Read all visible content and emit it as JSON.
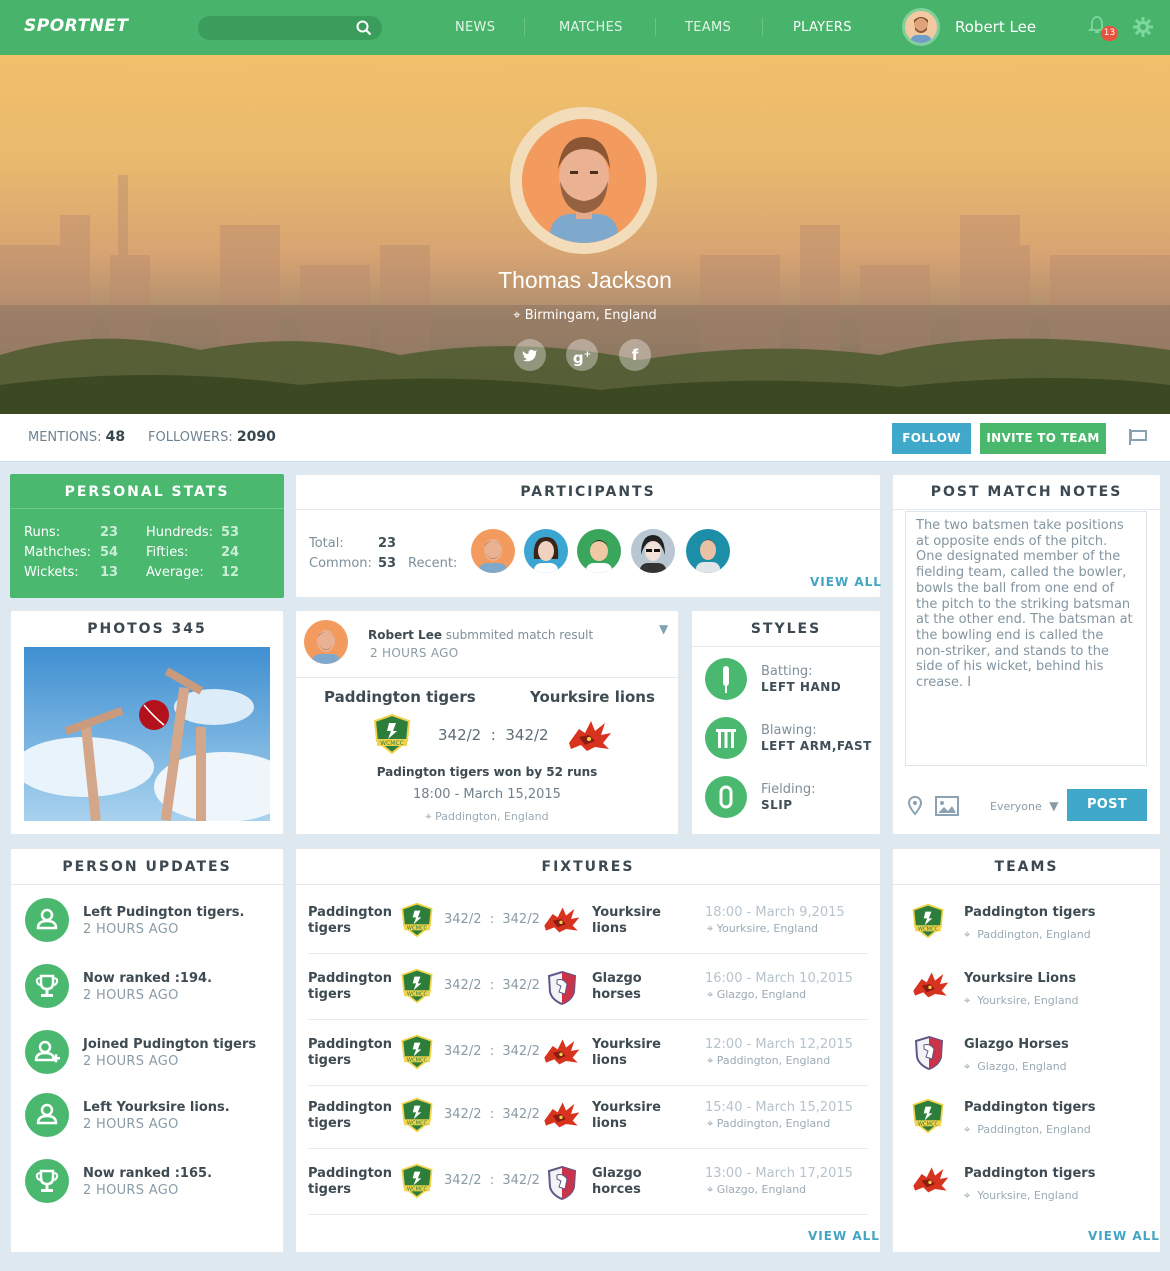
{
  "header": {
    "logo": "SPORTNET",
    "nav": [
      "NEWS",
      "MATCHES",
      "TEAMS",
      "PLAYERS"
    ],
    "user_name": "Robert Lee",
    "notification_count": "13"
  },
  "profile": {
    "name": "Thomas Jackson",
    "location": "Birmingam, England",
    "social": [
      "twitter",
      "google-plus",
      "facebook"
    ]
  },
  "stats_bar": {
    "mentions_label": "MENTIONS:",
    "mentions": "48",
    "followers_label": "FOLLOWERS:",
    "followers": "2090",
    "follow": "FOLLOW",
    "invite": "INVITE TO TEAM"
  },
  "personal_stats": {
    "title": "PERSONAL STATS",
    "rows": [
      {
        "l1": "Runs:",
        "v1": "23",
        "l2": "Hundreds:",
        "v2": "53"
      },
      {
        "l1": "Mathches:",
        "v1": "54",
        "l2": "Fifties:",
        "v2": "24"
      },
      {
        "l1": "Wickets:",
        "v1": "13",
        "l2": "Average:",
        "v2": "12"
      }
    ]
  },
  "participants": {
    "title": "PARTICIPANTS",
    "total_label": "Total:",
    "total": "23",
    "common_label": "Common:",
    "common": "53",
    "recent_label": "Recent:",
    "view_all": "VIEW ALL"
  },
  "post_notes": {
    "title": "POST MATCH NOTES",
    "text": "The two batsmen take positions at opposite ends of the pitch. One designated member of the fielding team, called the bowler, bowls the ball from one end of the pitch to the striking batsman at the other end. The batsman at the bowling end is called the non-striker, and stands to the side of his wicket, behind his crease. I",
    "audience": "Everyone",
    "post": "POST"
  },
  "photos": {
    "title": "PHOTOS 345"
  },
  "feed": {
    "author": "Robert Lee",
    "action": "submmited match result",
    "time": "2 HOURS AGO",
    "team_a": "Paddington tigers",
    "team_b": "Yourksire lions",
    "score_a": "342/2",
    "score_b": "342/2",
    "result": "Padington tigers won by 52 runs",
    "date": "18:00 - March 15,2015",
    "place": "Paddington, England"
  },
  "styles": {
    "title": "STYLES",
    "items": [
      {
        "label": "Batting:",
        "value": "LEFT HAND",
        "icon": "bat-icon"
      },
      {
        "label": "Blawing:",
        "value": "LEFT ARM,FAST",
        "icon": "wicket-icon"
      },
      {
        "label": "Fielding:",
        "value": "SLIP",
        "icon": "ball-icon"
      }
    ]
  },
  "person_updates": {
    "title": "PERSON UPDATES",
    "items": [
      {
        "text": "Left Pudington tigers.",
        "time": "2 HOURS AGO",
        "icon": "user-icon"
      },
      {
        "text": "Now ranked :194.",
        "time": "2 HOURS AGO",
        "icon": "trophy-icon"
      },
      {
        "text": "Joined Pudington tigers",
        "time": "2 HOURS AGO",
        "icon": "user-plus-icon"
      },
      {
        "text": "Left Yourksire lions.",
        "time": "2 HOURS AGO",
        "icon": "user-icon"
      },
      {
        "text": "Now ranked :165.",
        "time": "2 HOURS AGO",
        "icon": "trophy-icon"
      }
    ]
  },
  "fixtures": {
    "title": "FIXTURES",
    "rows": [
      {
        "home1": "Paddington",
        "home2": "tigers",
        "score_a": "342/2",
        "score_b": "342/2",
        "away1": "Yourksire",
        "away2": "lions",
        "time": "18:00 - March 9,2015",
        "place": "Yourksire, England",
        "away_logo": "lion"
      },
      {
        "home1": "Paddington",
        "home2": "tigers",
        "score_a": "342/2",
        "score_b": "342/2",
        "away1": "Glazgo",
        "away2": "horses",
        "time": "16:00 - March 10,2015",
        "place": "Glazgo, England",
        "away_logo": "horse"
      },
      {
        "home1": "Paddington",
        "home2": "tigers",
        "score_a": "342/2",
        "score_b": "342/2",
        "away1": "Yourksire",
        "away2": "lions",
        "time": "12:00 - March 12,2015",
        "place": "Paddington, England",
        "away_logo": "lion"
      },
      {
        "home1": "Paddington",
        "home2": "tigers",
        "score_a": "342/2",
        "score_b": "342/2",
        "away1": "Yourksire",
        "away2": "lions",
        "time": "15:40 - March 15,2015",
        "place": "Paddington, England",
        "away_logo": "lion"
      },
      {
        "home1": "Paddington",
        "home2": "tigers",
        "score_a": "342/2",
        "score_b": "342/2",
        "away1": "Glazgo",
        "away2": "horces",
        "time": "13:00 - March 17,2015",
        "place": "Glazgo, England",
        "away_logo": "horse"
      }
    ],
    "view_all": "VIEW ALL"
  },
  "teams": {
    "title": "TEAMS",
    "items": [
      {
        "name": "Paddington tigers",
        "place": "Paddington, England",
        "logo": "wcmcc"
      },
      {
        "name": "Yourksire Lions",
        "place": "Yourksire, England",
        "logo": "lion"
      },
      {
        "name": "Glazgo Horses",
        "place": "Glazgo, England",
        "logo": "horse"
      },
      {
        "name": "Paddington tigers",
        "place": "Paddington, England",
        "logo": "wcmcc"
      },
      {
        "name": "Paddington tigers",
        "place": "Yourksire, England",
        "logo": "lion"
      }
    ],
    "view_all": "VIEW ALL"
  },
  "colors": {
    "brand_green": "#47b36b",
    "accent_blue": "#43a4c4",
    "background": "#dde8f0"
  }
}
